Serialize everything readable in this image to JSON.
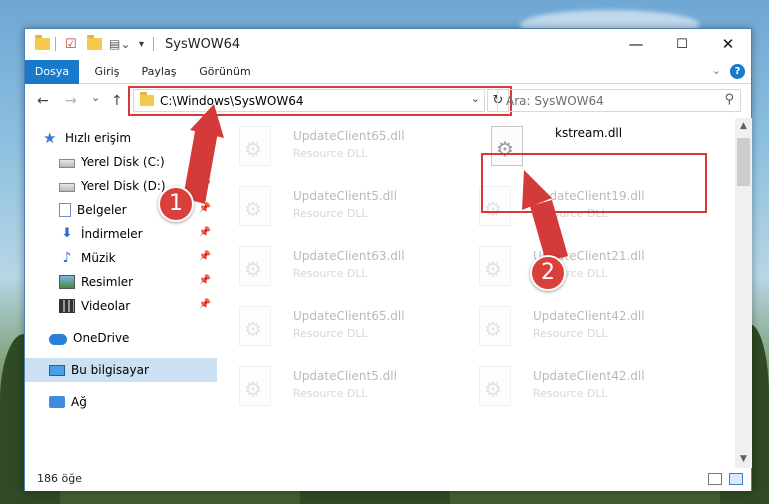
{
  "window": {
    "title": "SysWOW64",
    "minimize": "—",
    "maximize": "☐",
    "close": "✕"
  },
  "ribbon": {
    "tabs": [
      "Dosya",
      "Giriş",
      "Paylaş",
      "Görünüm"
    ],
    "active_tab": "Dosya",
    "help": "?"
  },
  "nav": {
    "back": "←",
    "forward": "→",
    "recent": "⌄",
    "up": "↑",
    "address": "C:\\Windows\\SysWOW64",
    "address_dropdown": "⌄",
    "refresh": "↻",
    "search_placeholder": "Ara: SysWOW64",
    "search_icon": "⚲"
  },
  "sidebar": {
    "items": [
      {
        "label": "Hızlı erişim",
        "icon": "star-icon"
      },
      {
        "label": "Yerel Disk (C:)",
        "icon": "drive-icon",
        "pinned": true
      },
      {
        "label": "Yerel Disk (D:)",
        "icon": "drive-icon",
        "pinned": true
      },
      {
        "label": "Belgeler",
        "icon": "documents-icon",
        "pinned": true
      },
      {
        "label": "İndirmeler",
        "icon": "downloads-icon",
        "pinned": true
      },
      {
        "label": "Müzik",
        "icon": "music-icon",
        "pinned": true
      },
      {
        "label": "Resimler",
        "icon": "pictures-icon",
        "pinned": true
      },
      {
        "label": "Videolar",
        "icon": "videos-icon",
        "pinned": true
      },
      {
        "label": "OneDrive",
        "icon": "onedrive-icon"
      },
      {
        "label": "Bu bilgisayar",
        "icon": "this-pc-icon",
        "selected": true
      },
      {
        "label": "Ağ",
        "icon": "network-icon"
      }
    ]
  },
  "files": {
    "left_column": [
      {
        "name": "UpdateClient65.dll",
        "type": "Resource DLL"
      },
      {
        "name": "UpdateClient5.dll",
        "type": "Resource DLL"
      },
      {
        "name": "UpdateClient63.dll",
        "type": "Resource DLL"
      },
      {
        "name": "UpdateClient65.dll",
        "type": "Resource DLL"
      },
      {
        "name": "UpdateClient5.dll",
        "type": "Resource DLL"
      }
    ],
    "right_column": [
      {
        "name": "kstream.dll",
        "type": "",
        "highlighted": true
      },
      {
        "name": "UpdateClient19.dll",
        "type": "Resource DLL"
      },
      {
        "name": "UpdateClient21.dll",
        "type": "Resource DLL"
      },
      {
        "name": "UpdateClient42.dll",
        "type": "Resource DLL"
      },
      {
        "name": "UpdateClient42.dll",
        "type": "Resource DLL"
      }
    ]
  },
  "status": {
    "item_count": "186 öğe"
  },
  "annotations": {
    "badge1": "1",
    "badge2": "2",
    "color": "#d53a3a"
  }
}
